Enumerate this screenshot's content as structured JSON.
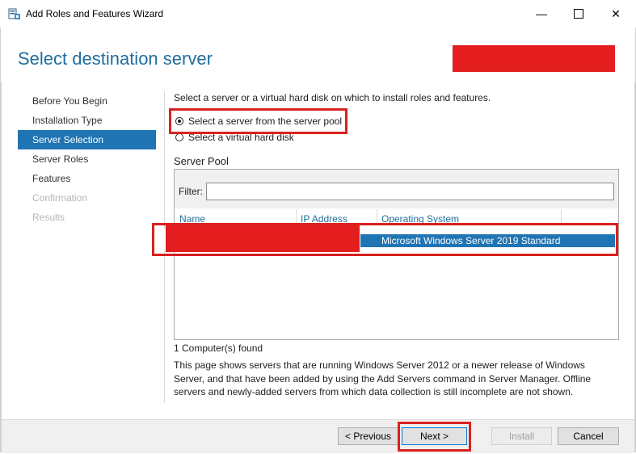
{
  "window": {
    "title": "Add Roles and Features Wizard",
    "controls": {
      "minimize": "—",
      "close": "✕"
    }
  },
  "header": {
    "page_title": "Select destination server"
  },
  "nav": {
    "items": [
      {
        "label": "Before You Begin",
        "state": "normal"
      },
      {
        "label": "Installation Type",
        "state": "normal"
      },
      {
        "label": "Server Selection",
        "state": "active"
      },
      {
        "label": "Server Roles",
        "state": "normal"
      },
      {
        "label": "Features",
        "state": "normal"
      },
      {
        "label": "Confirmation",
        "state": "disabled"
      },
      {
        "label": "Results",
        "state": "disabled"
      }
    ]
  },
  "content": {
    "intro": "Select a server or a virtual hard disk on which to install roles and features.",
    "options": [
      {
        "label": "Select a server from the server pool",
        "checked": true
      },
      {
        "label": "Select a virtual hard disk",
        "checked": false
      }
    ],
    "server_pool": {
      "label": "Server Pool",
      "filter_label": "Filter:",
      "filter_value": "",
      "columns": [
        "Name",
        "IP Address",
        "Operating System"
      ],
      "rows": [
        {
          "name": "",
          "ip": "",
          "os": "Microsoft Windows Server 2019 Standard",
          "selected": true
        }
      ]
    },
    "found_text": "1 Computer(s) found",
    "description": "This page shows servers that are running Windows Server 2012 or a newer release of Windows Server, and that have been added by using the Add Servers command in Server Manager. Offline servers and newly-added servers from which data collection is still incomplete are not shown."
  },
  "footer": {
    "previous_label": "< Previous",
    "next_label": "Next >",
    "install_label": "Install",
    "cancel_label": "Cancel"
  },
  "colors": {
    "accent": "#1f74b3",
    "title_blue": "#1f6e9e",
    "highlight_red": "#d9211f",
    "redaction": "#e41e1e"
  }
}
